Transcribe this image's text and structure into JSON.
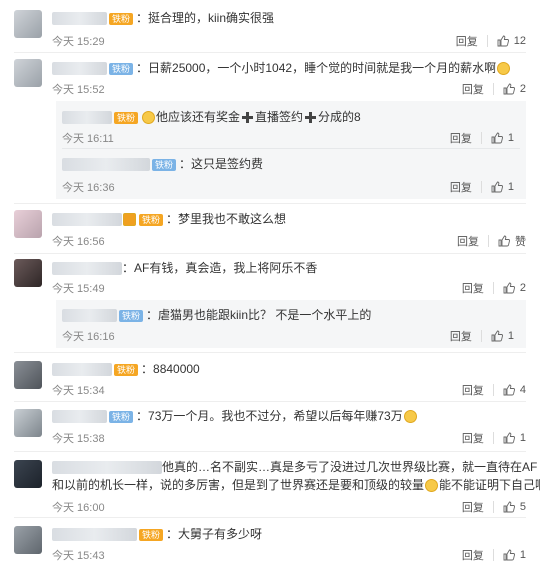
{
  "common": {
    "reply_label": "回复"
  },
  "comments": [
    {
      "badge": "铁粉",
      "text": "：挺合理的，kiin确实很强",
      "time": "今天 15:29",
      "likes": "12"
    },
    {
      "badge": "铁粉",
      "text": "：日薪25000，一个小时1042，睡个觉的时间就是我一个月的薪水啊",
      "time": "今天 15:52",
      "likes": "2",
      "replies": [
        {
          "badge": "铁粉",
          "text_a": "他应该还有奖金",
          "text_b": "直播签约",
          "text_c": "分成的8",
          "time": "今天 16:11",
          "likes": "1"
        },
        {
          "badge": "铁粉",
          "text": "：这只是签约费",
          "time": "今天 16:36",
          "likes": "1"
        }
      ]
    },
    {
      "badge": "铁粉",
      "text": "：梦里我也不敢这么想",
      "time": "今天 16:56",
      "likes": "赞"
    },
    {
      "text": "：AF有钱，真会造，我上将阿乐不香",
      "time": "今天 15:49",
      "likes": "2",
      "replies": [
        {
          "badge": "铁粉",
          "text": "：虐猫男也能跟kiin比？ 不是一个水平上的",
          "time": "今天 16:16",
          "likes": "1"
        }
      ]
    },
    {
      "badge": "铁粉",
      "text": "：8840000",
      "time": "今天 15:34",
      "likes": "4"
    },
    {
      "badge": "铁粉",
      "text": "：73万一个月。我也不过分，希望以后每年赚73万",
      "time": "今天 15:38",
      "likes": "1"
    },
    {
      "text_line1": "他真的…名不副实…真是多亏了没进过几次世界级比赛，就一直待在AF 就",
      "text_line2": "和以前的机长一样，说的多厉害，但是到了世界赛还是要和顶级的较量",
      "text_line2b": "能不能证明下自己啊",
      "time": "今天 16:00",
      "likes": "5"
    },
    {
      "badge": "铁粉",
      "text": "：大舅子有多少呀",
      "time": "今天 15:43",
      "likes": "1"
    }
  ]
}
